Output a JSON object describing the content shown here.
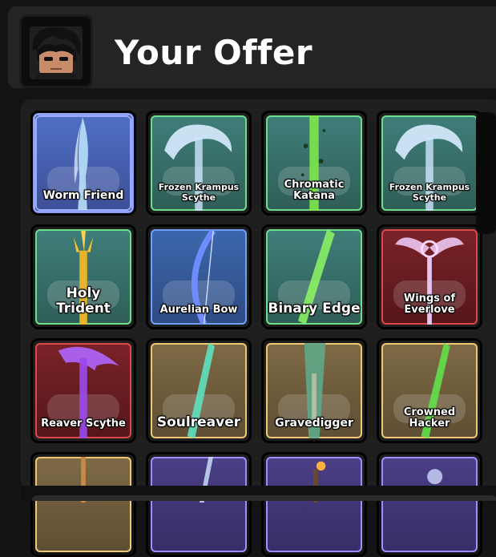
{
  "header": {
    "title": "Your Offer"
  },
  "items": [
    {
      "name": "Worm Friend",
      "rarity": "blue"
    },
    {
      "name": "Frozen Krampus Scythe",
      "rarity": "green"
    },
    {
      "name": "Chromatic Katana",
      "rarity": "green"
    },
    {
      "name": "Frozen Krampus Scythe",
      "rarity": "green"
    },
    {
      "name": "Holy Trident",
      "rarity": "green"
    },
    {
      "name": "Aurelian Bow",
      "rarity": "green"
    },
    {
      "name": "Binary Edge",
      "rarity": "green"
    },
    {
      "name": "Wings of Everlove",
      "rarity": "red"
    },
    {
      "name": "Reaver Scythe",
      "rarity": "red"
    },
    {
      "name": "Soulreaver",
      "rarity": "gold"
    },
    {
      "name": "Gravedigger",
      "rarity": "gold"
    },
    {
      "name": "Crowned Hacker",
      "rarity": "gold"
    }
  ],
  "rarity_colors": {
    "blue": "#8ea2ff",
    "green": "#6fe08a",
    "red": "#e04848",
    "gold": "#f0c874",
    "purple": "#a38cff"
  },
  "partially_visible_row": [
    "gold",
    "purple",
    "purple",
    "purple"
  ]
}
